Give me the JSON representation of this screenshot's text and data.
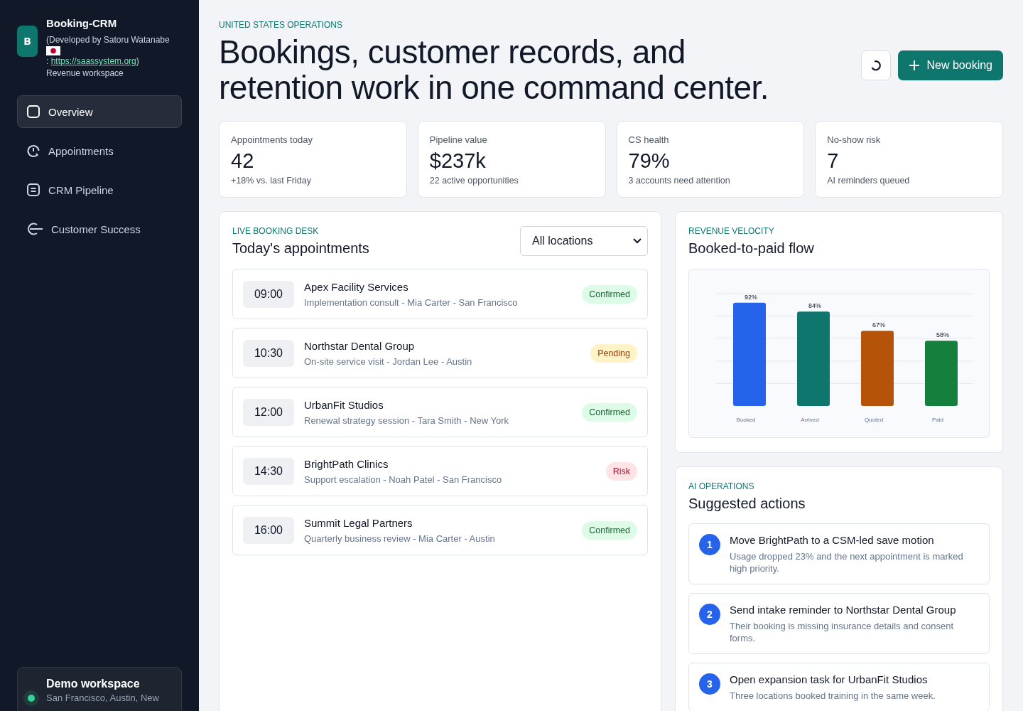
{
  "sidebar": {
    "brand": {
      "logo_letter": "B",
      "name": "Booking-CRM",
      "dev_note": "(Developed by Satoru Watanabe",
      "link_prefix": ":",
      "link": "https://saassystem.org",
      "link_suffix": ")",
      "subtitle": "Revenue workspace"
    },
    "nav": [
      {
        "label": "Overview",
        "selected": true
      },
      {
        "label": "Appointments",
        "selected": false
      },
      {
        "label": "CRM Pipeline",
        "selected": false
      },
      {
        "label": "Customer Success",
        "selected": false
      }
    ],
    "workspace": {
      "title": "Demo workspace",
      "locations": "San Francisco, Austin, New",
      "color": "#34d399"
    }
  },
  "header": {
    "eyebrow": "UNITED STATES OPERATIONS",
    "title": "Bookings, customer records, and retention work in one command center.",
    "new_button": "New booking"
  },
  "stats": [
    {
      "label": "Appointments today",
      "value": "42",
      "note": "+18% vs. last Friday"
    },
    {
      "label": "Pipeline value",
      "value": "$237k",
      "note": "22 active opportunities"
    },
    {
      "label": "CS health",
      "value": "79%",
      "note": "3 accounts need attention"
    },
    {
      "label": "No-show risk",
      "value": "7",
      "note": "AI reminders queued"
    }
  ],
  "booking_desk": {
    "eyebrow": "LIVE BOOKING DESK",
    "title": "Today's appointments",
    "location_select": "All locations",
    "appointments": [
      {
        "time": "09:00",
        "company": "Apex Facility Services",
        "details": "Implementation consult - Mia Carter - San Francisco",
        "status": "Confirmed",
        "kind": "success"
      },
      {
        "time": "10:30",
        "company": "Northstar Dental Group",
        "details": "On-site service visit - Jordan Lee - Austin",
        "status": "Pending",
        "kind": "warning"
      },
      {
        "time": "12:00",
        "company": "UrbanFit Studios",
        "details": "Renewal strategy session - Tara Smith - New York",
        "status": "Confirmed",
        "kind": "success"
      },
      {
        "time": "14:30",
        "company": "BrightPath Clinics",
        "details": "Support escalation - Noah Patel - San Francisco",
        "status": "Risk",
        "kind": "danger"
      },
      {
        "time": "16:00",
        "company": "Summit Legal Partners",
        "details": "Quarterly business review - Mia Carter - Austin",
        "status": "Confirmed",
        "kind": "success"
      }
    ]
  },
  "revenue": {
    "eyebrow": "REVENUE VELOCITY",
    "title": "Booked-to-paid flow",
    "chart_data": {
      "type": "bar",
      "data_labels": true,
      "categories": [
        "Booked",
        "Arrived",
        "Quoted",
        "Paid"
      ],
      "series": [
        {
          "values": [
            92,
            84,
            67,
            58
          ]
        }
      ],
      "colors": [
        "#2563eb",
        "#0f766e",
        "#b45309",
        "#15803d"
      ]
    },
    "bar_label_suffix": "%"
  },
  "ai_ops": {
    "eyebrow": "AI OPERATIONS",
    "title": "Suggested actions",
    "actions": [
      {
        "number": "1",
        "title": "Move BrightPath to a CSM-led save motion",
        "text": "Usage dropped 23% and the next appointment is marked high priority."
      },
      {
        "number": "2",
        "title": "Send intake reminder to Northstar Dental Group",
        "text": "Their booking is missing insurance details and consent forms."
      },
      {
        "number": "3",
        "title": "Open expansion task for UrbanFit Studios",
        "text": "Three locations booked training in the same week."
      }
    ]
  }
}
